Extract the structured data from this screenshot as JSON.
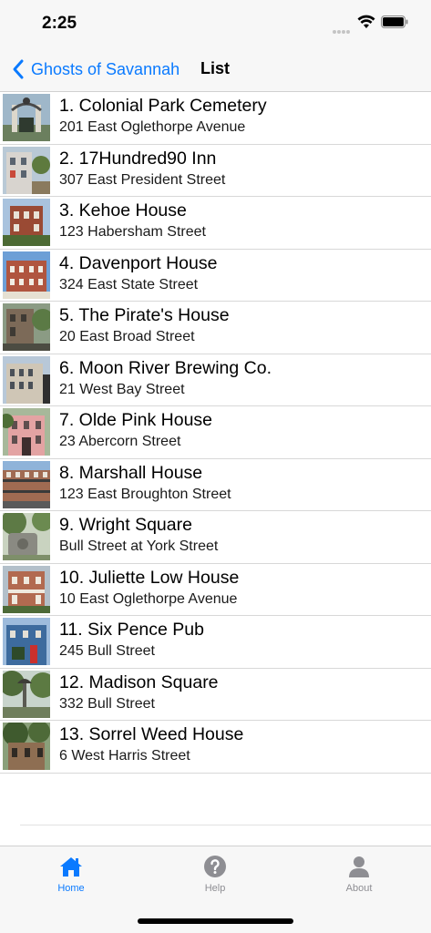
{
  "status_bar": {
    "time": "2:25"
  },
  "nav": {
    "back_label": "Ghosts of Savannah",
    "title": "List"
  },
  "list": [
    {
      "title": "1. Colonial Park Cemetery",
      "subtitle": "201 East Oglethorpe Avenue"
    },
    {
      "title": "2. 17Hundred90 Inn",
      "subtitle": "307 East President Street"
    },
    {
      "title": "3. Kehoe House",
      "subtitle": "123 Habersham Street"
    },
    {
      "title": "4. Davenport House",
      "subtitle": "324 East State Street"
    },
    {
      "title": "5. The Pirate's House",
      "subtitle": "20 East Broad Street"
    },
    {
      "title": "6. Moon River Brewing Co.",
      "subtitle": "21 West Bay Street"
    },
    {
      "title": "7. Olde Pink House",
      "subtitle": "23 Abercorn Street"
    },
    {
      "title": "8. Marshall House",
      "subtitle": "123 East Broughton Street"
    },
    {
      "title": "9. Wright Square",
      "subtitle": "Bull Street at York Street"
    },
    {
      "title": "10. Juliette Low House",
      "subtitle": "10 East Oglethorpe Avenue"
    },
    {
      "title": "11. Six Pence Pub",
      "subtitle": "245 Bull Street"
    },
    {
      "title": "12. Madison Square",
      "subtitle": "332 Bull Street"
    },
    {
      "title": "13. Sorrel Weed House",
      "subtitle": "6 West Harris Street"
    }
  ],
  "tabs": {
    "home": {
      "label": "Home",
      "icon": "home-icon"
    },
    "help": {
      "label": "Help",
      "icon": "question-icon"
    },
    "about": {
      "label": "About",
      "icon": "person-icon"
    }
  },
  "colors": {
    "accent": "#0a7aff",
    "inactive": "#8e8e93"
  }
}
